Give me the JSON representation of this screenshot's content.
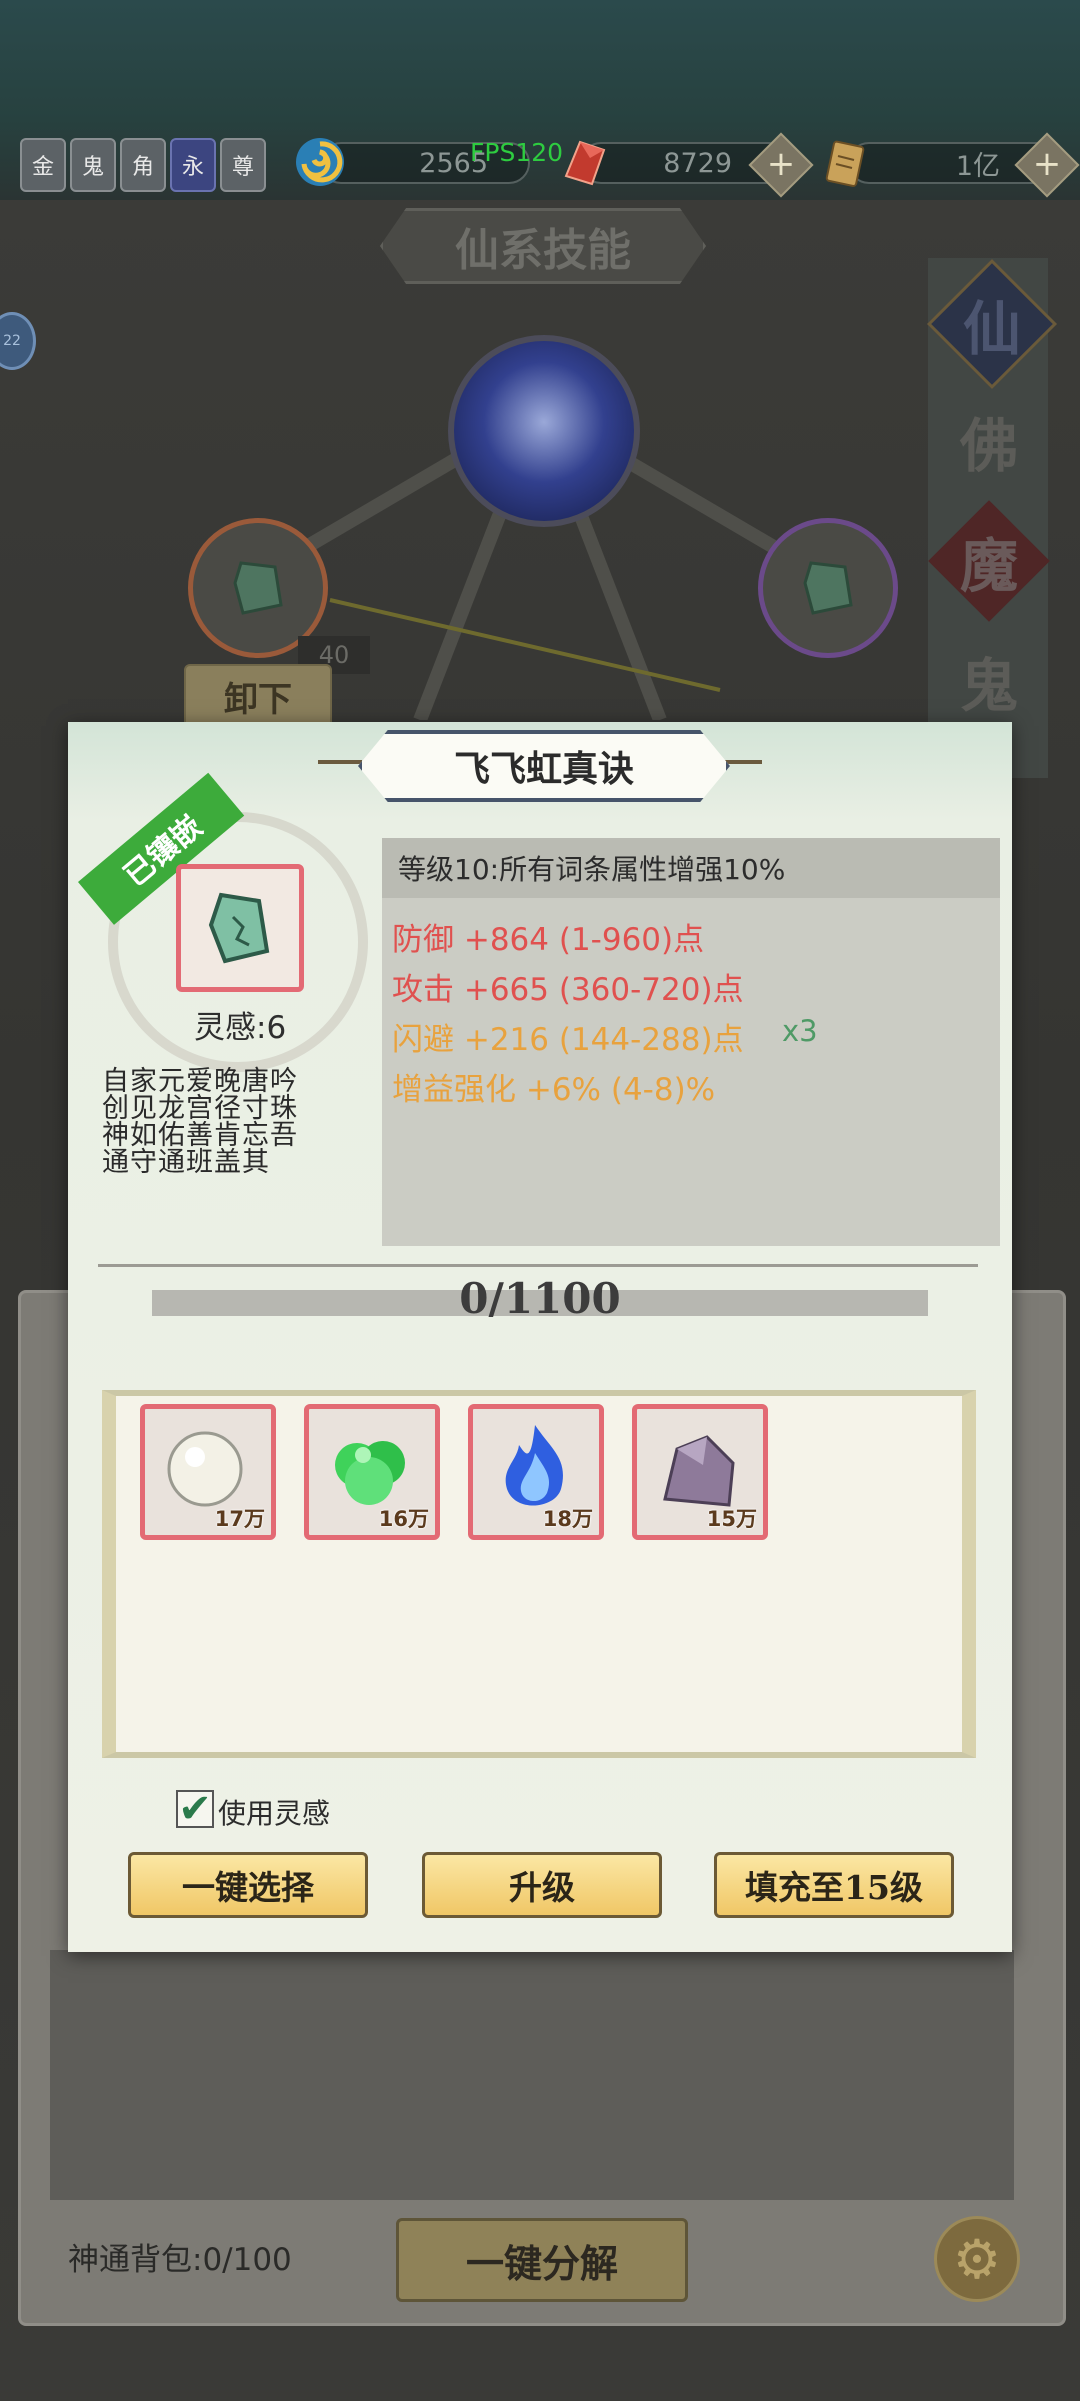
{
  "topbar": {
    "tags": [
      "金",
      "鬼",
      "角",
      "永",
      "尊"
    ],
    "resources": [
      {
        "icon": "swirl-coin-icon",
        "value": "2565"
      },
      {
        "icon": "red-crystal-icon",
        "value": "8729"
      },
      {
        "icon": "scroll-ticket-icon",
        "value": "1亿"
      }
    ],
    "fps": "FPS120"
  },
  "background": {
    "section_title": "仙系技能",
    "side_badge": "22",
    "vertical_tabs": [
      "仙",
      "佛",
      "魔",
      "鬼"
    ],
    "slot_level": "40",
    "unload_button": "卸下",
    "pack_label": "神通背包:0/100",
    "decompose_button": "一键分解"
  },
  "modal": {
    "title": "飞飞虹真诀",
    "ribbon": "已镶嵌",
    "inspire": "灵感:6",
    "poem_lines": [
      "自家元爱晚唐吟",
      "创见龙宫径寸珠",
      "神如佑善肯忘吾",
      "通守通班盖其"
    ],
    "attr_header": "等级10:所有词条属性增强10%",
    "attributes": [
      {
        "text": "防御  +864  (1-960)点",
        "color": "#e0514f",
        "suffix": ""
      },
      {
        "text": "攻击  +665  (360-720)点",
        "color": "#e0514f",
        "suffix": ""
      },
      {
        "text": "闪避  +216  (144-288)点",
        "color": "#e8a23e",
        "suffix": "x3"
      },
      {
        "text": "增益强化  +6%  (4-8)%",
        "color": "#e8a23e",
        "suffix": ""
      }
    ],
    "progress_text": "0/1100",
    "progress_fraction": 0,
    "materials": [
      {
        "icon": "pearl-icon",
        "count": "17万"
      },
      {
        "icon": "green-herb-icon",
        "count": "16万"
      },
      {
        "icon": "blue-flame-icon",
        "count": "18万"
      },
      {
        "icon": "purple-ore-icon",
        "count": "15万"
      }
    ],
    "use_inspire_label": "使用灵感",
    "use_inspire_checked": true,
    "buttons": {
      "select": "一键选择",
      "upgrade": "升级",
      "fill": "填充至15级"
    }
  }
}
